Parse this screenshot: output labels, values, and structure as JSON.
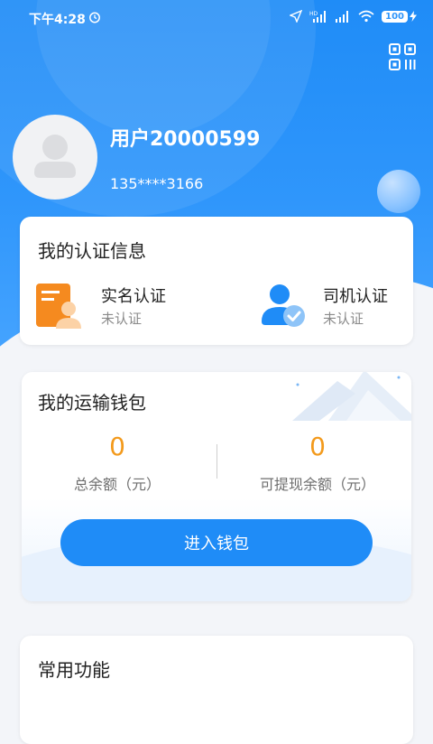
{
  "status_bar": {
    "time": "下午4:28",
    "battery": "100",
    "network_label": "HD"
  },
  "profile": {
    "username": "用户20000599",
    "phone": "135****3166"
  },
  "certification": {
    "title": "我的认证信息",
    "items": [
      {
        "label": "实名认证",
        "status": "未认证",
        "icon": "id-card-icon"
      },
      {
        "label": "司机认证",
        "status": "未认证",
        "icon": "driver-verified-icon"
      }
    ]
  },
  "wallet": {
    "title": "我的运输钱包",
    "total_balance": {
      "value": "0",
      "label": "总余额（元）"
    },
    "withdrawable_balance": {
      "value": "0",
      "label": "可提现余额（元）"
    },
    "enter_button": "进入钱包"
  },
  "functions": {
    "title": "常用功能"
  },
  "colors": {
    "primary": "#1f8cf7",
    "amount": "#f39a1c",
    "orange_icon": "#f58a1f"
  }
}
